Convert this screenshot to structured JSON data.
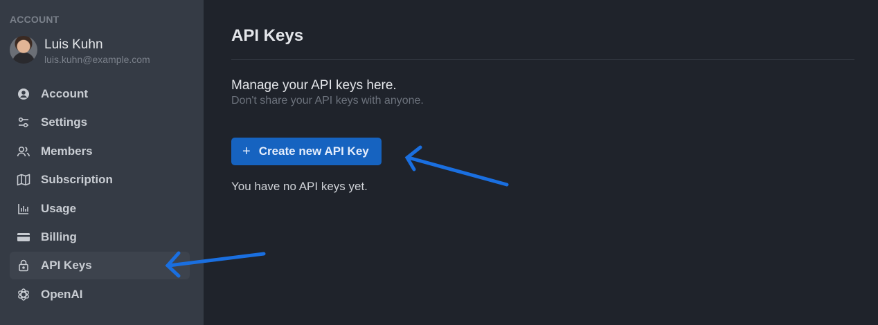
{
  "sidebar": {
    "section_label": "ACCOUNT",
    "profile": {
      "name": "Luis Kuhn",
      "email": "luis.kuhn@example.com"
    },
    "items": [
      {
        "label": "Account",
        "icon": "user-circle-icon"
      },
      {
        "label": "Settings",
        "icon": "sliders-icon"
      },
      {
        "label": "Members",
        "icon": "users-icon"
      },
      {
        "label": "Subscription",
        "icon": "map-icon"
      },
      {
        "label": "Usage",
        "icon": "bar-chart-icon"
      },
      {
        "label": "Billing",
        "icon": "credit-card-icon"
      },
      {
        "label": "API Keys",
        "icon": "lock-icon",
        "active": true
      },
      {
        "label": "OpenAI",
        "icon": "openai-icon"
      }
    ]
  },
  "main": {
    "title": "API Keys",
    "heading": "Manage your API keys here.",
    "subheading": "Don't share your API keys with anyone.",
    "create_button": {
      "icon": "plus-icon",
      "label": "Create new API Key"
    },
    "empty_message": "You have no API keys yet."
  },
  "colors": {
    "sidebar_bg": "#353b45",
    "main_bg": "#1f232b",
    "accent": "#1663c0",
    "annotation_arrow": "#1a6fe0"
  }
}
